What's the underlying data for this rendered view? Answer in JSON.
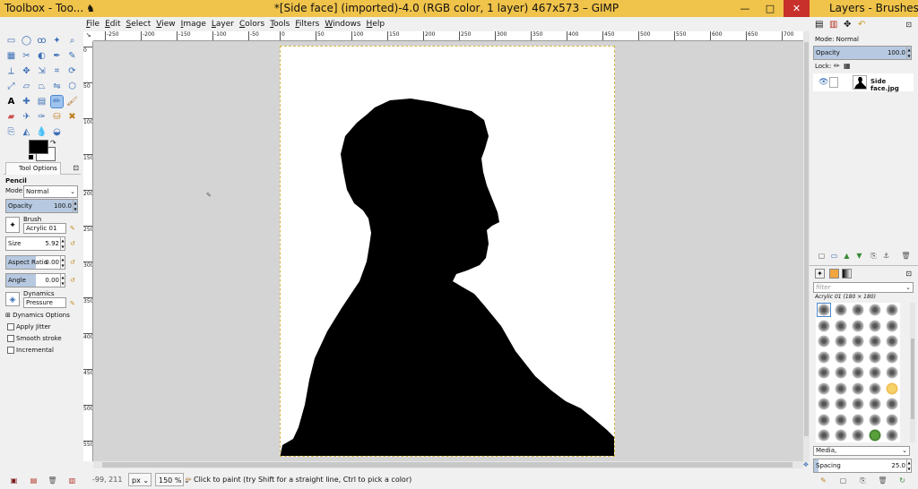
{
  "toolbox": {
    "title": "Toolbox - Too...",
    "tab_label": "Tool Options",
    "tool_name": "Pencil",
    "mode_label": "Mode:",
    "mode_value": "Normal",
    "opacity": {
      "label": "Opacity",
      "value": "100.0",
      "fraction": 1.0
    },
    "brush_label": "Brush",
    "brush_value": "Acrylic 01",
    "size": {
      "label": "Size",
      "value": "5.92"
    },
    "aspect": {
      "label": "Aspect Ratio",
      "value": "0.00"
    },
    "angle": {
      "label": "Angle",
      "value": "0.00"
    },
    "dynamics_label": "Dynamics",
    "dynamics_value": "Pressure Opacity",
    "dynamics_options": "Dynamics Options",
    "apply_jitter": "Apply Jitter",
    "smooth_stroke": "Smooth stroke",
    "incremental": "Incremental",
    "fg_color": "#000000",
    "bg_color": "#ffffff",
    "tools": [
      "rect-select",
      "ellipse-select",
      "free-select",
      "fuzzy-select",
      "by-color-select",
      "scissors",
      "foreground-select",
      "paths",
      "color-picker",
      "zoom",
      "measure",
      "move",
      "align",
      "crop",
      "rotate",
      "scale",
      "shear",
      "perspective",
      "flip",
      "cage",
      "text",
      "heal",
      "clone",
      "blend",
      "pencil",
      "paintbrush",
      "eraser",
      "airbrush",
      "ink",
      "smudge",
      "dodge",
      "blur",
      "bucket-fill",
      "convolve",
      "smudge2"
    ]
  },
  "main": {
    "title": "*[Side face] (imported)-4.0 (RGB color, 1 layer) 467x573 – GIMP",
    "menu": [
      "File",
      "Edit",
      "Select",
      "View",
      "Image",
      "Layer",
      "Colors",
      "Tools",
      "Filters",
      "Windows",
      "Help"
    ],
    "ruler_h": [
      "-250",
      "-200",
      "-150",
      "-100",
      "-50",
      "0",
      "50",
      "100",
      "150",
      "200",
      "250",
      "300",
      "350",
      "400",
      "450",
      "500",
      "550",
      "600",
      "650",
      "700"
    ],
    "ruler_v": [
      "0",
      "50",
      "100",
      "150",
      "200",
      "250",
      "300",
      "350",
      "400",
      "450",
      "500",
      "550"
    ],
    "status": {
      "coords": "-99, 211",
      "unit": "px",
      "zoom": "150 %",
      "message": "Click to paint (try Shift for a straight line, Ctrl to pick a color)"
    },
    "win_buttons": {
      "min": "—",
      "max": "□",
      "close": "✕"
    }
  },
  "layers": {
    "title": "Layers - Brushes",
    "mode_label": "Mode:",
    "mode_value": "Normal",
    "opacity": {
      "label": "Opacity",
      "value": "100.0",
      "fraction": 1.0
    },
    "lock_label": "Lock:",
    "layer_name": "Side face.jpg",
    "filter_placeholder": "filter",
    "brush_caption": "Acrylic 01 (180 × 180)",
    "media_label": "Media,",
    "spacing": {
      "label": "Spacing",
      "value": "25.0",
      "fraction": 0.05
    }
  }
}
